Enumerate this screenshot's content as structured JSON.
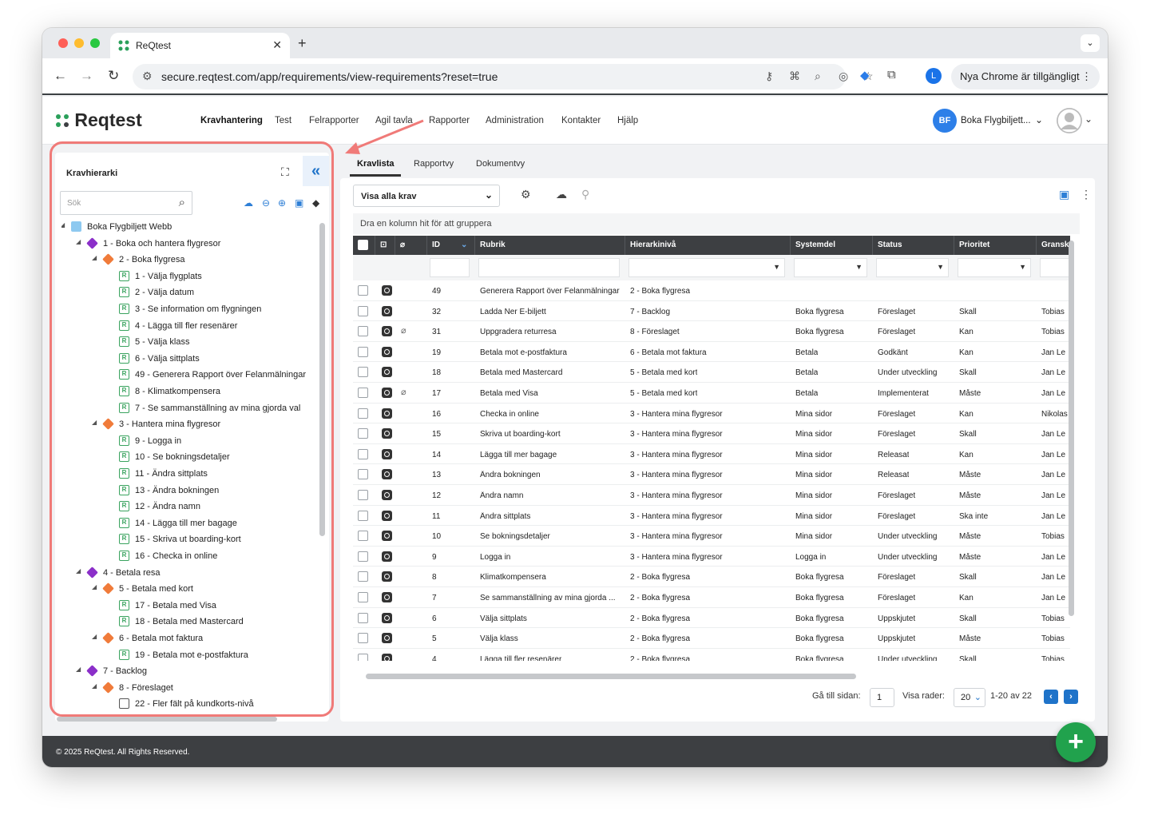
{
  "browser": {
    "tab_title": "ReQtest",
    "url": "secure.reqtest.com/app/requirements/view-requirements?reset=true",
    "profile_initial": "L",
    "update_label": "Nya Chrome är tillgängligt"
  },
  "app": {
    "brand": "Reqtest",
    "menu": [
      "Kravhantering",
      "Test",
      "Felrapporter",
      "Agil tavla",
      "Rapporter",
      "Administration",
      "Kontakter",
      "Hjälp"
    ],
    "user_initials": "BF",
    "user_project": "Boka Flygbiljett..."
  },
  "left": {
    "title": "Kravhierarki",
    "search_placeholder": "Sök",
    "tree": [
      {
        "label": "Boka Flygbiljett Webb",
        "level": 0,
        "type": "folder"
      },
      {
        "label": "1 - Boka och hantera flygresor",
        "level": 1,
        "type": "epic"
      },
      {
        "label": "2 - Boka flygresa",
        "level": 2,
        "type": "feat"
      },
      {
        "label": "1 - Välja flygplats",
        "level": 3,
        "type": "req"
      },
      {
        "label": "2 - Välja datum",
        "level": 3,
        "type": "req"
      },
      {
        "label": "3 - Se information om flygningen",
        "level": 3,
        "type": "req"
      },
      {
        "label": "4 - Lägga till fler resenärer",
        "level": 3,
        "type": "req"
      },
      {
        "label": "5 - Välja klass",
        "level": 3,
        "type": "req"
      },
      {
        "label": "6 - Välja sittplats",
        "level": 3,
        "type": "req"
      },
      {
        "label": "49 - Generera Rapport över Felanmälningar",
        "level": 3,
        "type": "req"
      },
      {
        "label": "8 - Klimatkompensera",
        "level": 3,
        "type": "req"
      },
      {
        "label": "7 - Se sammanställning av mina gjorda val",
        "level": 3,
        "type": "req"
      },
      {
        "label": "3 - Hantera mina flygresor",
        "level": 2,
        "type": "feat"
      },
      {
        "label": "9 - Logga in",
        "level": 3,
        "type": "req"
      },
      {
        "label": "10 - Se bokningsdetaljer",
        "level": 3,
        "type": "req"
      },
      {
        "label": "11 - Ändra sittplats",
        "level": 3,
        "type": "req"
      },
      {
        "label": "13 - Ändra bokningen",
        "level": 3,
        "type": "req"
      },
      {
        "label": "12 - Ändra namn",
        "level": 3,
        "type": "req"
      },
      {
        "label": "14 - Lägga till mer bagage",
        "level": 3,
        "type": "req"
      },
      {
        "label": "15 - Skriva ut boarding-kort",
        "level": 3,
        "type": "req"
      },
      {
        "label": "16 - Checka in online",
        "level": 3,
        "type": "req"
      },
      {
        "label": "4 - Betala resa",
        "level": 1,
        "type": "epic"
      },
      {
        "label": "5 - Betala med kort",
        "level": 2,
        "type": "feat"
      },
      {
        "label": "17 - Betala med Visa",
        "level": 3,
        "type": "req"
      },
      {
        "label": "18 - Betala med Mastercard",
        "level": 3,
        "type": "req"
      },
      {
        "label": "6 - Betala mot faktura",
        "level": 2,
        "type": "feat"
      },
      {
        "label": "19 - Betala mot e-postfaktura",
        "level": 3,
        "type": "req"
      },
      {
        "label": "7 - Backlog",
        "level": 1,
        "type": "epic"
      },
      {
        "label": "8 - Föreslaget",
        "level": 2,
        "type": "feat"
      },
      {
        "label": "22 - Fler fält på kundkorts-nivå",
        "level": 3,
        "type": "task"
      }
    ]
  },
  "right": {
    "tabs": [
      "Kravlista",
      "Rapportvy",
      "Dokumentvy"
    ],
    "filter_value": "Visa alla krav",
    "group_hint": "Dra en kolumn hit för att gruppera",
    "columns": [
      "ID",
      "Rubrik",
      "Hierarkinivå",
      "Systemdel",
      "Status",
      "Prioritet",
      "Gransk"
    ],
    "rows": [
      {
        "id": "49",
        "rubrik": "Generera Rapport över Felanmälningar",
        "niva": "2 - Boka flygresa",
        "system": "",
        "status": "",
        "prio": "",
        "gransk": "",
        "clip": false
      },
      {
        "id": "32",
        "rubrik": "Ladda Ner E-biljett",
        "niva": "7 - Backlog",
        "system": "Boka flygresa",
        "status": "Föreslaget",
        "prio": "Skall",
        "gransk": "Tobias",
        "clip": false
      },
      {
        "id": "31",
        "rubrik": "Uppgradera returresa",
        "niva": "8 - Föreslaget",
        "system": "Boka flygresa",
        "status": "Föreslaget",
        "prio": "Kan",
        "gransk": "Tobias",
        "clip": true
      },
      {
        "id": "19",
        "rubrik": "Betala mot e-postfaktura",
        "niva": "6 - Betala mot faktura",
        "system": "Betala",
        "status": "Godkänt",
        "prio": "Kan",
        "gransk": "Jan Le",
        "clip": false
      },
      {
        "id": "18",
        "rubrik": "Betala med Mastercard",
        "niva": "5 - Betala med kort",
        "system": "Betala",
        "status": "Under utveckling",
        "prio": "Skall",
        "gransk": "Jan Le",
        "clip": false
      },
      {
        "id": "17",
        "rubrik": "Betala med Visa",
        "niva": "5 - Betala med kort",
        "system": "Betala",
        "status": "Implementerat",
        "prio": "Måste",
        "gransk": "Jan Le",
        "clip": true
      },
      {
        "id": "16",
        "rubrik": "Checka in online",
        "niva": "3 - Hantera mina flygresor",
        "system": "Mina sidor",
        "status": "Föreslaget",
        "prio": "Kan",
        "gransk": "Nikolas",
        "clip": false
      },
      {
        "id": "15",
        "rubrik": "Skriva ut boarding-kort",
        "niva": "3 - Hantera mina flygresor",
        "system": "Mina sidor",
        "status": "Föreslaget",
        "prio": "Skall",
        "gransk": "Jan Le",
        "clip": false
      },
      {
        "id": "14",
        "rubrik": "Lägga till mer bagage",
        "niva": "3 - Hantera mina flygresor",
        "system": "Mina sidor",
        "status": "Releasat",
        "prio": "Kan",
        "gransk": "Jan Le",
        "clip": false
      },
      {
        "id": "13",
        "rubrik": "Ändra bokningen",
        "niva": "3 - Hantera mina flygresor",
        "system": "Mina sidor",
        "status": "Releasat",
        "prio": "Måste",
        "gransk": "Jan Le",
        "clip": false
      },
      {
        "id": "12",
        "rubrik": "Ändra namn",
        "niva": "3 - Hantera mina flygresor",
        "system": "Mina sidor",
        "status": "Föreslaget",
        "prio": "Måste",
        "gransk": "Jan Le",
        "clip": false
      },
      {
        "id": "11",
        "rubrik": "Ändra sittplats",
        "niva": "3 - Hantera mina flygresor",
        "system": "Mina sidor",
        "status": "Föreslaget",
        "prio": "Ska inte",
        "gransk": "Jan Le",
        "clip": false
      },
      {
        "id": "10",
        "rubrik": "Se bokningsdetaljer",
        "niva": "3 - Hantera mina flygresor",
        "system": "Mina sidor",
        "status": "Under utveckling",
        "prio": "Måste",
        "gransk": "Tobias",
        "clip": false
      },
      {
        "id": "9",
        "rubrik": "Logga in",
        "niva": "3 - Hantera mina flygresor",
        "system": "Logga in",
        "status": "Under utveckling",
        "prio": "Måste",
        "gransk": "Jan Le",
        "clip": false
      },
      {
        "id": "8",
        "rubrik": "Klimatkompensera",
        "niva": "2 - Boka flygresa",
        "system": "Boka flygresa",
        "status": "Föreslaget",
        "prio": "Skall",
        "gransk": "Jan Le",
        "clip": false
      },
      {
        "id": "7",
        "rubrik": "Se sammanställning av mina gjorda ...",
        "niva": "2 - Boka flygresa",
        "system": "Boka flygresa",
        "status": "Föreslaget",
        "prio": "Kan",
        "gransk": "Jan Le",
        "clip": false
      },
      {
        "id": "6",
        "rubrik": "Välja sittplats",
        "niva": "2 - Boka flygresa",
        "system": "Boka flygresa",
        "status": "Uppskjutet",
        "prio": "Skall",
        "gransk": "Tobias",
        "clip": false
      },
      {
        "id": "5",
        "rubrik": "Välja klass",
        "niva": "2 - Boka flygresa",
        "system": "Boka flygresa",
        "status": "Uppskjutet",
        "prio": "Måste",
        "gransk": "Tobias",
        "clip": false
      },
      {
        "id": "4",
        "rubrik": "Lägga till fler resenärer",
        "niva": "2 - Boka flygresa",
        "system": "Boka flygresa",
        "status": "Under utveckling",
        "prio": "Skall",
        "gransk": "Tobias",
        "clip": false
      }
    ],
    "pager": {
      "goto_label": "Gå till sidan:",
      "page": "1",
      "rows_label": "Visa rader:",
      "rows_value": "20",
      "range": "1-20 av 22"
    }
  },
  "footer": "© 2025 ReQtest. All Rights Reserved.",
  "colors": {
    "accent": "#1f73c9",
    "highlight": "#f07a78",
    "fab": "#21a24d"
  }
}
